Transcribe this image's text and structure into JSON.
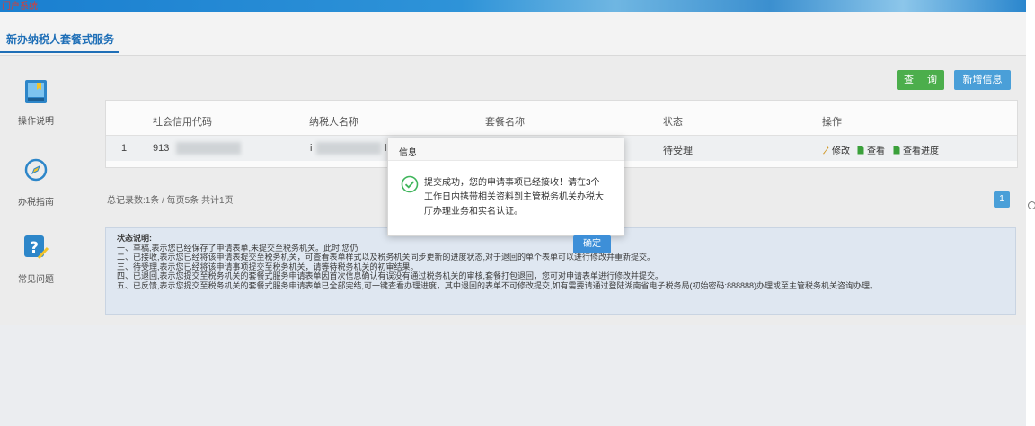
{
  "header": {
    "banner_text": "门户系统"
  },
  "tabs": [
    {
      "label": "新办纳税人套餐式服务"
    }
  ],
  "sidebar": {
    "items": [
      {
        "label": "操作说明",
        "icon": "book-icon"
      },
      {
        "label": "办税指南",
        "icon": "compass-icon"
      },
      {
        "label": "常见问题",
        "icon": "question-icon"
      }
    ]
  },
  "toolbar": {
    "query_label": "查 询",
    "add_label": "新增信息"
  },
  "table": {
    "columns": [
      "社会信用代码",
      "纳税人名称",
      "套餐名称",
      "状态",
      "操作"
    ],
    "rows": [
      {
        "index": "1",
        "credit_code": "913",
        "taxpayer_name": "i",
        "taxpayer_suffix": "l",
        "package": "",
        "status": "待受理",
        "actions": [
          "修改",
          "查看",
          "查看进度"
        ]
      }
    ]
  },
  "pager": {
    "summary": "总记录数:1条 / 每页5条 共计1页",
    "current_page": "1"
  },
  "notes": {
    "title": "状态说明:",
    "lines": [
      "一、草稿,表示您已经保存了申请表单,未提交至税务机关。此时,您仍",
      "二、已接收,表示您已经将该申请表提交至税务机关，可查看表单样式以及税务机关同步更新的进度状态,对于退回的单个表单可以进行修改并重新提交。",
      "三、待受理,表示您已经将该申请事项提交至税务机关，请等待税务机关的初审结果。",
      "四、已退回,表示您提交至税务机关的套餐式服务申请表单因首次信息确认有误没有通过税务机关的审核,套餐打包退回，您可对申请表单进行修改并提交。",
      "五、已反馈,表示您提交至税务机关的套餐式服务申请表单已全部完结,可一键查看办理进度，其中退回的表单不可修改提交,如有需要请通过登陆湖南省电子税务局(初始密码:888888)办理或至主管税务机关咨询办理。"
    ]
  },
  "dialog": {
    "title": "信息",
    "message": "提交成功，您的申请事项已经接收！请在3个工作日内携带相关资料到主管税务机关办税大厅办理业务和实名认证。",
    "ok_label": "确定"
  },
  "colors": {
    "primary": "#4a9fd8",
    "success": "#4cae4c",
    "link_blue": "#1f6fb7",
    "banner_red": "#e23b2d"
  }
}
